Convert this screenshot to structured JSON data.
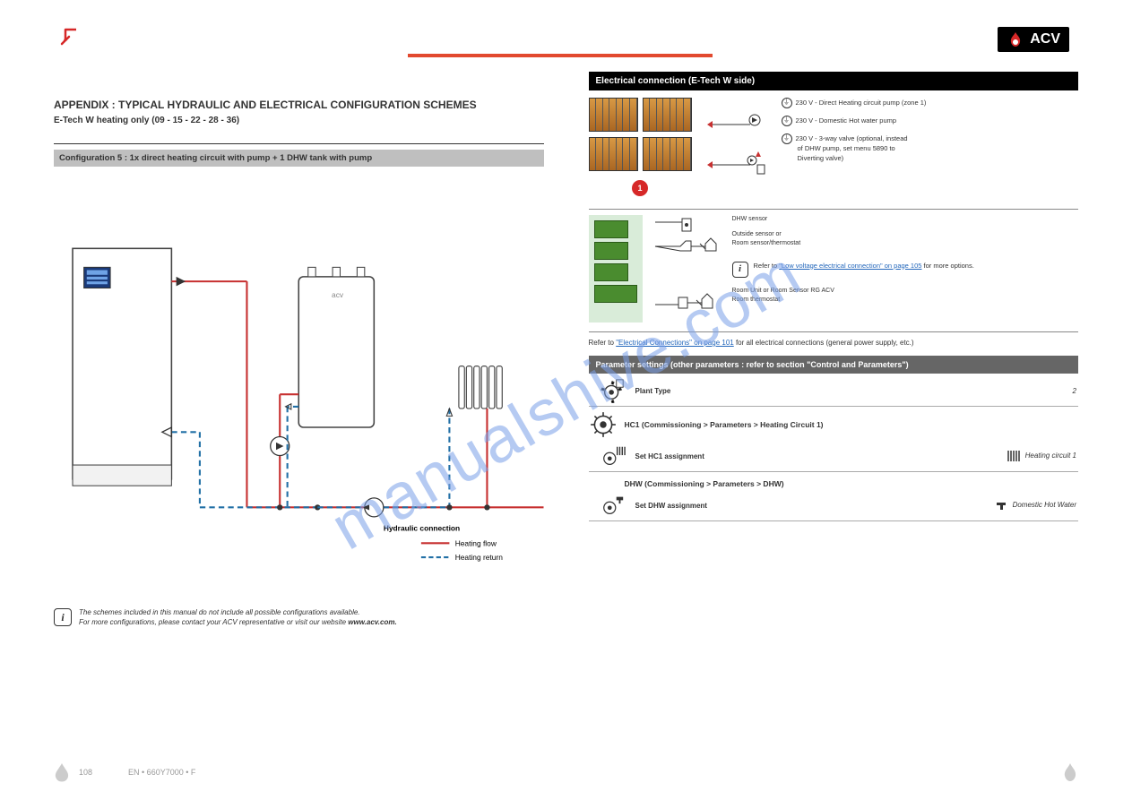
{
  "header": {
    "brand": "ACV"
  },
  "left_col": {
    "title": "APPENDIX : TYPICAL HYDRAULIC AND ELECTRICAL CONFIGURATION SCHEMES",
    "subtitle": "E-Tech W heating only (09 - 15 - 22 - 28 - 36)",
    "config_header": "Configuration 5 : 1x direct heating circuit with pump + 1 DHW tank with pump",
    "hydraulic_legend_label": "Hydraulic connection",
    "hydraulic_legend_flow": "Heating flow",
    "hydraulic_legend_return": "Heating return",
    "remark_lead": "The schemes included in this manual do not include all possible configurations available.",
    "remark_lead2": "For more configurations, please contact your ACV representative or visit our website",
    "remark_website": "www.acv.com."
  },
  "right_col": {
    "elec_header": "Electrical connection (E-Tech W side)",
    "red_circle": "1",
    "earth_notes": {
      "p1": "230 V - Direct Heating circuit pump (zone 1)",
      "p2": "230 V - Domestic Hot water pump",
      "p3a": "230 V - 3-way valve (optional, instead",
      "p3b": "of DHW pump, set menu 5890 to",
      "p3c": "Diverting valve)"
    },
    "lv": {
      "s1": "DHW sensor",
      "s2a": "Outside sensor or",
      "s2b": "Room sensor/thermostat",
      "s3a": "Room Unit or Room Sensor RG ACV",
      "s3b": "Room thermostat"
    },
    "lv_note": "Refer to \"Low voltage electrical connection\" on page 105 for more options.",
    "general_note": "Refer to \"Electrical Connections\" on page 101 for all electrical connections (general power supply, etc.)",
    "settings_header": "Parameter settings (other parameters : refer to section \"Control and Parameters\")",
    "params": {
      "plant_label": "Plant Type",
      "plant_value": "2",
      "hc1_section": "HC1 (Commissioning > Parameters > Heating Circuit 1)",
      "hc1_assign_label": "Set HC1 assignment",
      "hc1_assign_value": "Heating circuit 1",
      "dhw_section": "DHW (Commissioning > Parameters > DHW)",
      "dhw_assign_label": "Set DHW assignment",
      "dhw_assign_value": "Domestic Hot Water"
    }
  },
  "footer": {
    "page_num_left": "108",
    "doc_ref": "EN • 660Y7000 • F",
    "page_num_right": ""
  },
  "watermark": "manualshive.com"
}
